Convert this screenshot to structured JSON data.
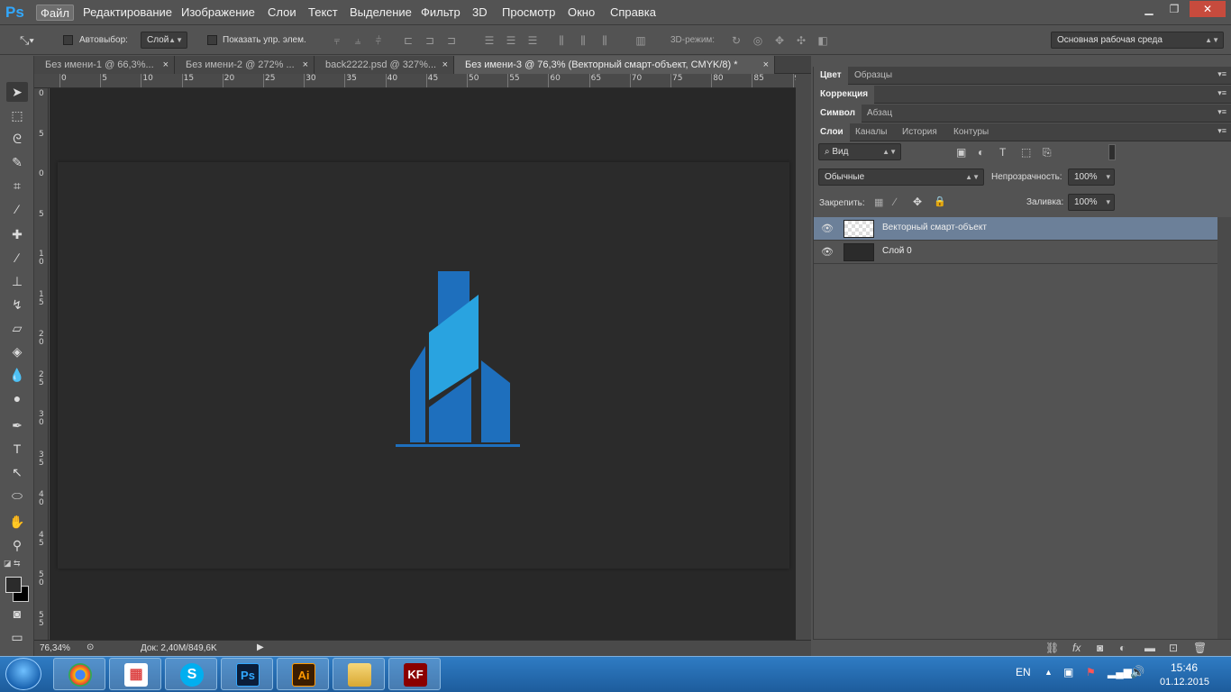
{
  "app": {
    "logo": "Ps",
    "name": "Adobe Photoshop"
  },
  "menu": [
    "Файл",
    "Редактирование",
    "Изображение",
    "Слои",
    "Текст",
    "Выделение",
    "Фильтр",
    "3D",
    "Просмотр",
    "Окно",
    "Справка"
  ],
  "options": {
    "autoselect_label": "Автовыбор:",
    "autoselect_value": "Слой",
    "show_controls_label": "Показать упр. элем.",
    "mode3d_label": "3D-режим:",
    "workspace_value": "Основная рабочая среда"
  },
  "tabs": [
    {
      "label": "Без имени-1 @ 66,3%...",
      "close": "×",
      "active": false
    },
    {
      "label": "Без имени-2 @ 272% ...",
      "close": "×",
      "active": false
    },
    {
      "label": "back2222.psd @ 327%...",
      "close": "×",
      "active": false
    },
    {
      "label": "Без имени-3 @ 76,3% (Векторный смарт-объект, CMYK/8) *",
      "close": "×",
      "active": true
    }
  ],
  "ruler_top": [
    "0",
    "5",
    "10",
    "15",
    "20",
    "25",
    "30",
    "35",
    "40",
    "45",
    "50",
    "55",
    "60",
    "65",
    "70",
    "75",
    "80",
    "85",
    "9"
  ],
  "ruler_left": [
    "0",
    "5",
    "0",
    "5",
    "1 0",
    "1 5",
    "2 0",
    "2 5",
    "3 0",
    "3 5",
    "4 0",
    "4 5",
    "5 0",
    "5 5",
    "6"
  ],
  "status": {
    "zoom": "76,34%",
    "doc": "Док: 2,40M/849,6K"
  },
  "panels": {
    "row1": [
      "Цвет",
      "Образцы"
    ],
    "row2": [
      "Коррекция"
    ],
    "row3": [
      "Символ",
      "Абзац"
    ],
    "row4": [
      "Слои",
      "Каналы",
      "История",
      "Контуры"
    ]
  },
  "layers_panel": {
    "filter_label": "Вид",
    "blend_mode": "Обычные",
    "opacity_label": "Непрозрачность:",
    "opacity_value": "100%",
    "lock_label": "Закрепить:",
    "fill_label": "Заливка:",
    "fill_value": "100%",
    "layers": [
      {
        "name": "Векторный смарт-объект",
        "visible": true,
        "selected": true
      },
      {
        "name": "Слой 0",
        "visible": true,
        "selected": false
      }
    ]
  },
  "logo_colors": {
    "dark": "#1e6fbd",
    "light": "#29a3e0",
    "base": "#1e6fbd"
  },
  "taskbar": {
    "apps": [
      "chrome",
      "apps-grid",
      "skype",
      "Ps",
      "Ai",
      "explorer",
      "KF"
    ],
    "lang": "EN",
    "time": "15:46",
    "date": "01.12.2015"
  }
}
